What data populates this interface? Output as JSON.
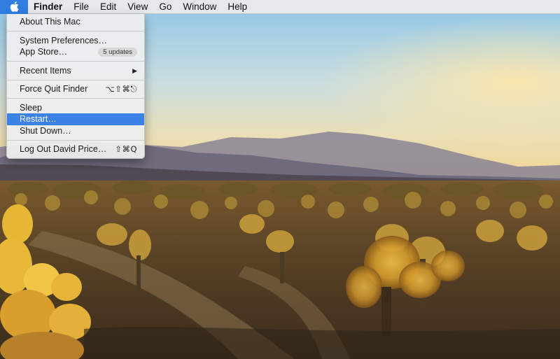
{
  "menubar": {
    "apple_icon": "apple-icon",
    "app_name": "Finder",
    "items": [
      "File",
      "Edit",
      "View",
      "Go",
      "Window",
      "Help"
    ]
  },
  "apple_menu": {
    "about": "About This Mac",
    "system_preferences": "System Preferences…",
    "app_store": "App Store…",
    "app_store_badge": "5 updates",
    "recent_items": "Recent Items",
    "recent_items_arrow": "▶",
    "force_quit": "Force Quit Finder",
    "force_quit_shortcut": "⌥⇧⌘⎋",
    "sleep": "Sleep",
    "restart": "Restart…",
    "shut_down": "Shut Down…",
    "log_out": "Log Out David Price…",
    "log_out_shortcut": "⇧⌘Q",
    "highlight_color": "#3b82e6"
  },
  "desktop": {
    "wallpaper": "desert-cholla-cactus-garden-sunrise"
  }
}
